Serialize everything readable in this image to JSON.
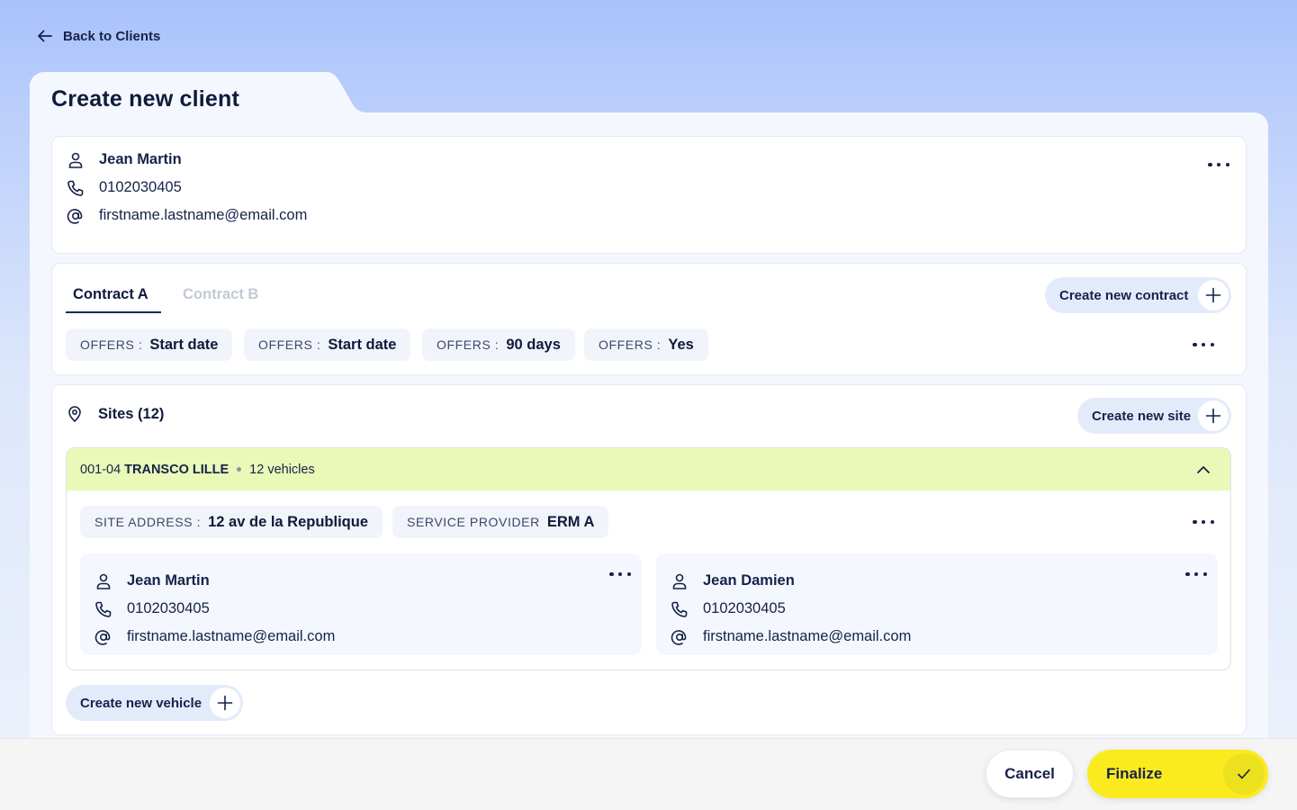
{
  "nav": {
    "back_label": "Back to Clients"
  },
  "page": {
    "title": "Create new client"
  },
  "client": {
    "name": "Jean Martin",
    "phone": "0102030405",
    "email": "firstname.lastname@email.com"
  },
  "contracts": {
    "tabs": [
      {
        "label": "Contract A",
        "active": true
      },
      {
        "label": "Contract B",
        "active": false
      }
    ],
    "create_label": "Create new contract",
    "offers": [
      {
        "key": "OFFERS :",
        "value": "Start date"
      },
      {
        "key": "OFFERS :",
        "value": "Start date"
      },
      {
        "key": "OFFERS :",
        "value": "90 days"
      },
      {
        "key": "OFFERS :",
        "value": "Yes"
      }
    ]
  },
  "sites": {
    "title": "Sites (12)",
    "create_label": "Create new site",
    "site": {
      "code": "001-04",
      "name": "TRANSCO LILLE",
      "vehicles": "12 vehicles",
      "address_key": "SITE ADDRESS :",
      "address_value": "12 av de la Republique",
      "provider_key": "SERVICE PROVIDER",
      "provider_value": "ERM A",
      "contacts": [
        {
          "name": "Jean Martin",
          "phone": "0102030405",
          "email": "firstname.lastname@email.com"
        },
        {
          "name": "Jean Damien",
          "phone": "0102030405",
          "email": "firstname.lastname@email.com"
        }
      ]
    },
    "create_vehicle_label": "Create new vehicle"
  },
  "footer": {
    "cancel_label": "Cancel",
    "finalize_label": "Finalize"
  },
  "colors": {
    "accent_yellow": "#fbeb1e",
    "site_header_bg": "#eaf9b7",
    "pill_bg": "#e3ebfb",
    "text_dark": "#16224a"
  }
}
